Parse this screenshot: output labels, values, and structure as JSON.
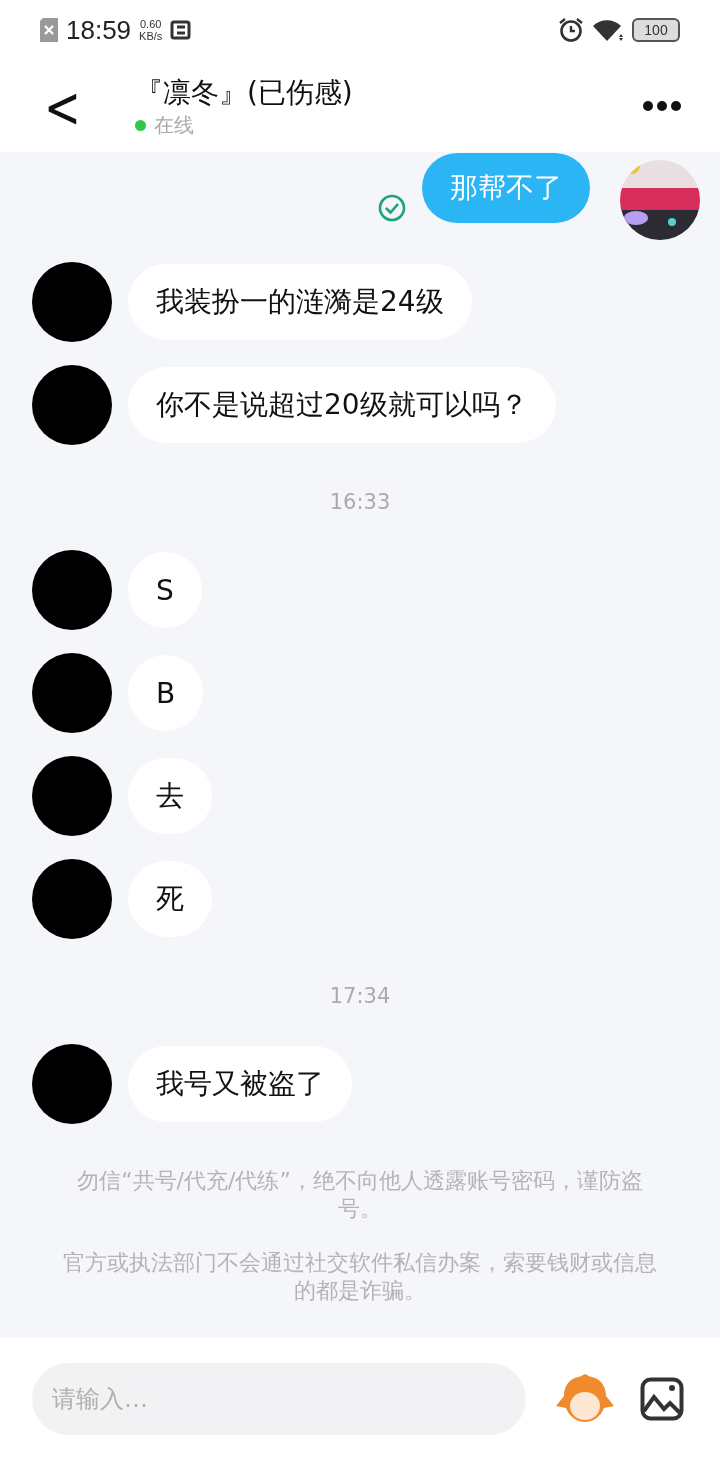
{
  "status_bar": {
    "time": "18:59",
    "speed_value": "0.60",
    "speed_unit": "KB/s",
    "battery": "100"
  },
  "header": {
    "back": "<",
    "title": "『凛冬』(已伤感)",
    "online": true,
    "status": "在线"
  },
  "messages": [
    {
      "kind": "outgoing",
      "text": "那帮不了",
      "delivered": true
    },
    {
      "kind": "incoming",
      "text": "我装扮一的涟漪是24级"
    },
    {
      "kind": "incoming",
      "text": "你不是说超过20级就可以吗？"
    },
    {
      "kind": "time",
      "text": "16:33"
    },
    {
      "kind": "incoming",
      "text": "S"
    },
    {
      "kind": "incoming",
      "text": "B"
    },
    {
      "kind": "incoming",
      "text": "去"
    },
    {
      "kind": "incoming",
      "text": "死"
    },
    {
      "kind": "time",
      "text": "17:34"
    },
    {
      "kind": "incoming",
      "text": "我号又被盗了"
    }
  ],
  "notices": [
    "勿信“共号/代充/代练”，绝不向他人透露账号密码，谨防盗号。",
    "官方或执法部门不会通过社交软件私信办案，索要钱财或信息的都是诈骗。"
  ],
  "input": {
    "placeholder": "请输入…"
  }
}
